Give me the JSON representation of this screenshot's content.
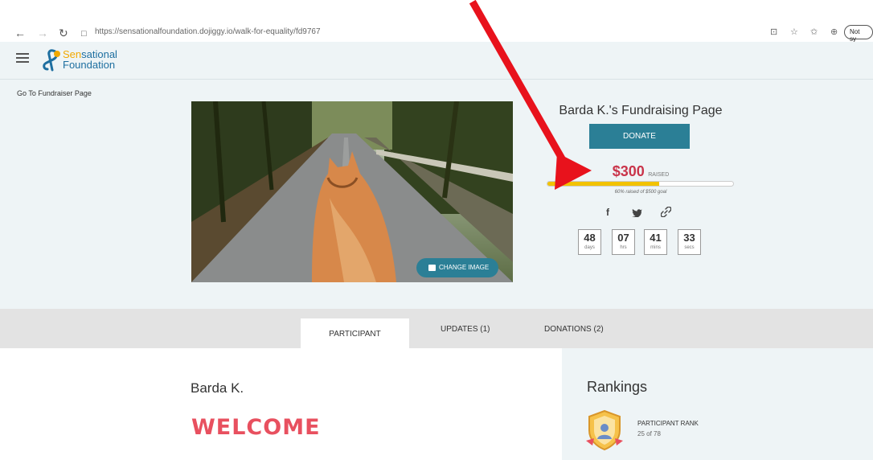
{
  "browser": {
    "url": "https://sensationalfoundation.dojiggy.io/walk-for-equality/fd9767",
    "profile_label": "Not sy"
  },
  "header": {
    "logo_line1_a": "Sen",
    "logo_line1_b": "sational",
    "logo_line2": "Foundation"
  },
  "hero": {
    "go_link": "Go To Fundraiser Page",
    "change_image_label": "CHANGE IMAGE",
    "title": "Barda K.'s Fundraising Page",
    "donate_label": "DONATE",
    "raised_amount": "$300",
    "raised_label": "RAISED",
    "progress_fraction": 0.6,
    "goal_note": "60% raised of $500 goal",
    "countdown": [
      {
        "value": "48",
        "unit": "days"
      },
      {
        "value": "07",
        "unit": "hrs"
      },
      {
        "value": "41",
        "unit": "mins"
      },
      {
        "value": "33",
        "unit": "secs"
      }
    ]
  },
  "tabs": {
    "participant": "PARTICIPANT",
    "updates": "UPDATES (1)",
    "donations": "DONATIONS (2)"
  },
  "main": {
    "participant_name": "Barda K.",
    "welcome": "WELCOME"
  },
  "rankings": {
    "title": "Rankings",
    "rank_label": "PARTICIPANT RANK",
    "rank_value": "25 of 78"
  },
  "colors": {
    "accent": "#2b7f96",
    "raised": "#c9344a",
    "progress": "#f2c200",
    "annotation_arrow": "#e8121c"
  }
}
